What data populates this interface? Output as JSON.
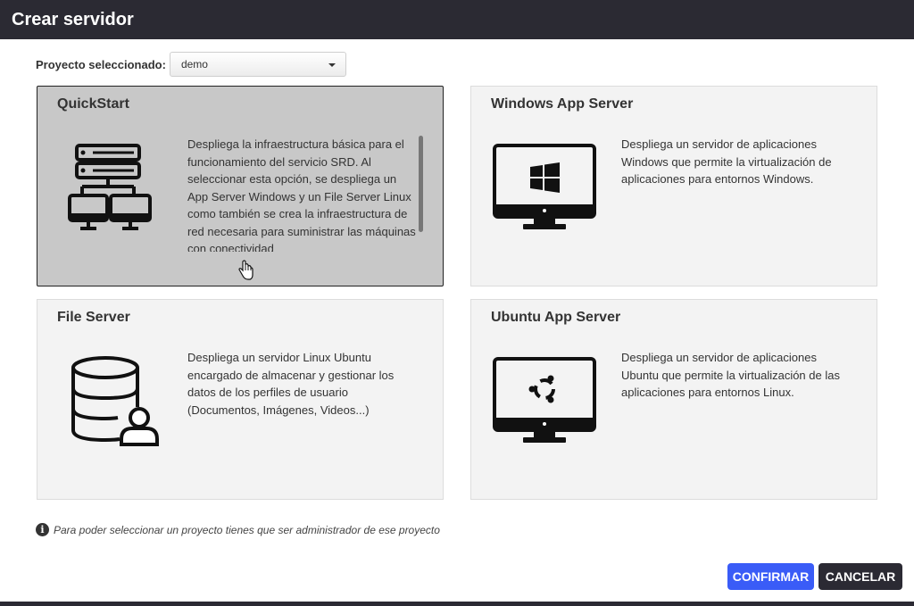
{
  "header": {
    "title": "Crear servidor"
  },
  "project": {
    "label": "Proyecto seleccionado:",
    "selected": "demo"
  },
  "cards": [
    {
      "title": "QuickStart",
      "icon": "server-network-icon",
      "description": "Despliega la infraestructura básica para el funcionamiento del servicio SRD. Al seleccionar esta opción, se despliega un App Server Windows y un File Server Linux como también se crea la infraestructura de red necesaria para suministrar las máquinas con conectividad",
      "selected": true
    },
    {
      "title": "Windows App Server",
      "icon": "windows-monitor-icon",
      "description": "Despliega un servidor de aplicaciones Windows que permite la virtualización de aplicaciones para entornos Windows.",
      "selected": false
    },
    {
      "title": "File Server",
      "icon": "database-user-icon",
      "description": "Despliega un servidor Linux Ubuntu encargado de almacenar y gestionar los datos de los perfiles de usuario (Documentos, Imágenes, Videos...)",
      "selected": false
    },
    {
      "title": "Ubuntu App Server",
      "icon": "ubuntu-monitor-icon",
      "description": "Despliega un servidor de aplicaciones Ubuntu que permite la virtualización de las aplicaciones para entornos Linux.",
      "selected": false
    }
  ],
  "footer": {
    "note": "Para poder seleccionar un proyecto tienes que ser administrador de ese proyecto"
  },
  "buttons": {
    "confirm": "CONFIRMAR",
    "cancel": "CANCELAR"
  },
  "colors": {
    "header": "#2b2a33",
    "confirm": "#3a5cf7",
    "selected_card": "#c8c8c8",
    "card": "#f3f3f3"
  }
}
